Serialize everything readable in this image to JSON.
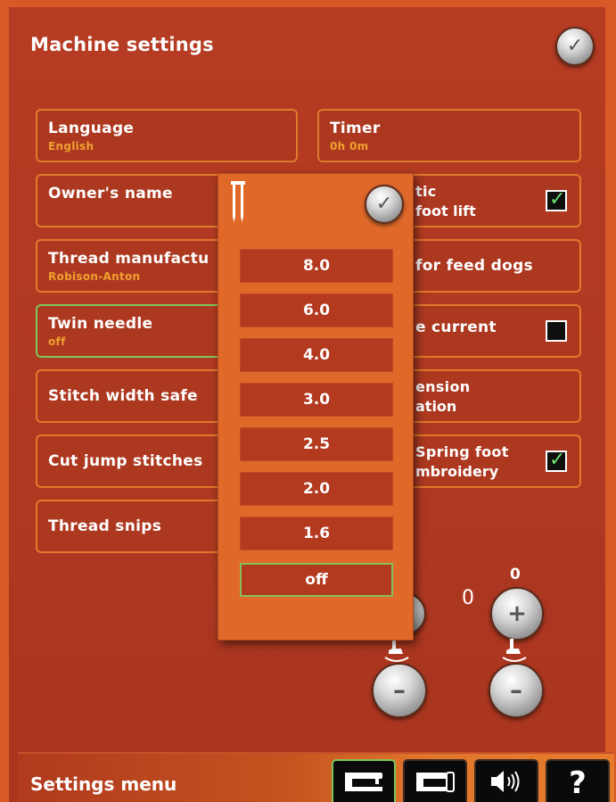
{
  "header": {
    "title": "Machine settings",
    "confirm_icon": "check-icon"
  },
  "settings": {
    "language": {
      "label": "Language",
      "value": "English"
    },
    "timer": {
      "label": "Timer",
      "value": "0h 0m"
    },
    "owners_name": {
      "label": "Owner's name"
    },
    "automatic_foot_lift": {
      "label_line1": "tic",
      "label_line2": "foot lift",
      "checked": true
    },
    "thread_manufacturer": {
      "label": "Thread manufactu",
      "value": "Robison-Anton"
    },
    "feed_dogs": {
      "label": "for feed dogs"
    },
    "twin_needle": {
      "label": "Twin needle",
      "value": "off"
    },
    "save_current": {
      "label": "e current",
      "checked": false
    },
    "stitch_width_safety": {
      "label": "Stitch width safe"
    },
    "tension_compensation": {
      "label_line1": "ension",
      "label_line2": "ation"
    },
    "cut_jump_stitches": {
      "label": "Cut jump stitches"
    },
    "spring_foot_embroidery": {
      "label_line1": "Spring foot",
      "label_line2": "mbroidery",
      "checked": true
    },
    "thread_snips": {
      "label": "Thread snips"
    }
  },
  "popup": {
    "icon": "twin-needle-icon",
    "options": [
      "8.0",
      "6.0",
      "4.0",
      "3.0",
      "2.5",
      "2.0",
      "1.6",
      "off"
    ],
    "selected": "off"
  },
  "presser_foot": {
    "right_value": "0",
    "right_prefix": "0",
    "plus": "+",
    "minus": "–"
  },
  "bottom": {
    "title": "Settings menu",
    "help": "?"
  },
  "colors": {
    "background": "#b23a22",
    "accent": "#e07a2c",
    "selected": "#86c05a",
    "value": "#f0a030"
  }
}
